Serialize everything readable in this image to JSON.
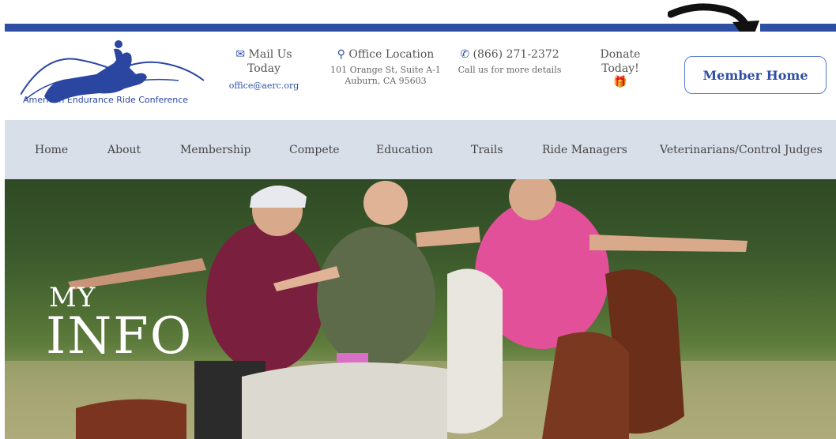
{
  "header": {
    "logo_text": "American Endurance Ride Conference",
    "mail": {
      "icon": "envelope-icon",
      "title": "Mail Us Today",
      "email": "office@aerc.org"
    },
    "office": {
      "icon": "map-pin-icon",
      "title": "Office Location",
      "line1": "101 Orange St, Suite A-1",
      "line2": "Auburn, CA 95603"
    },
    "phone": {
      "icon": "phone-icon",
      "title": "(866) 271-2372",
      "line1": "Call us for more details"
    },
    "donate": {
      "title": "Donate Today!",
      "icon": "gift-icon"
    },
    "member_button": "Member Home"
  },
  "nav": {
    "items": [
      "Home",
      "About",
      "Membership",
      "Compete",
      "Education",
      "Trails",
      "Ride Managers",
      "Veterinarians/Control Judges"
    ]
  },
  "hero": {
    "title_line1": "MY",
    "title_line2": "INFO"
  },
  "colors": {
    "brand_blue": "#2f4fa5",
    "nav_bg": "#d9dfe8"
  }
}
